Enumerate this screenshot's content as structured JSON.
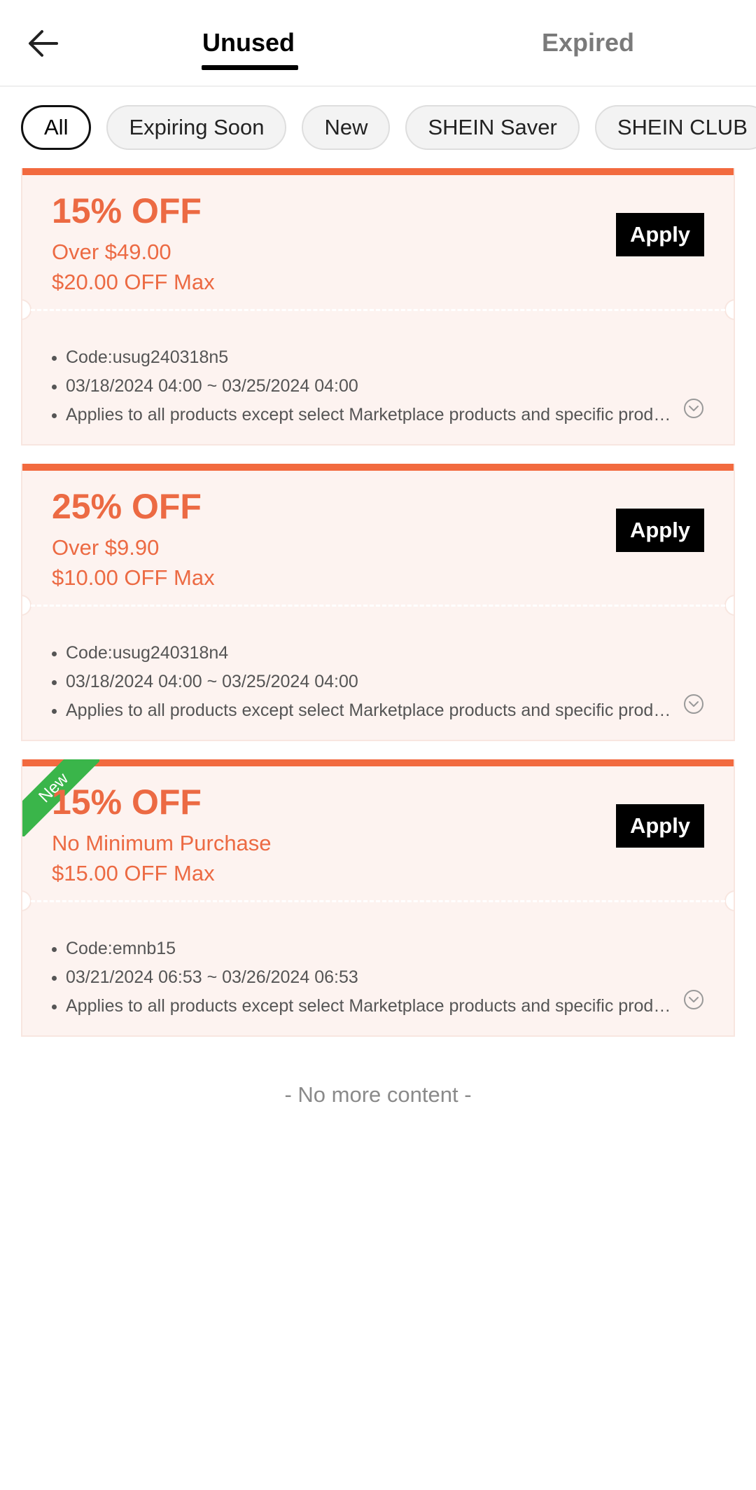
{
  "header": {
    "tabs": [
      {
        "label": "Unused",
        "active": true
      },
      {
        "label": "Expired",
        "active": false
      }
    ]
  },
  "filters": [
    "All",
    "Expiring Soon",
    "New",
    "SHEIN Saver",
    "SHEIN CLUB"
  ],
  "coupons": [
    {
      "discount": "15% OFF",
      "condition": "Over $49.00",
      "max": "$20.00 OFF Max",
      "apply_label": "Apply",
      "code": "Code:usug240318n5",
      "validity": "03/18/2024  04:00 ~ 03/25/2024  04:00",
      "description": "Applies to all products except select Marketplace products and specific products"
    },
    {
      "discount": "25% OFF",
      "condition": "Over $9.90",
      "max": "$10.00 OFF Max",
      "apply_label": "Apply",
      "code": "Code:usug240318n4",
      "validity": "03/18/2024  04:00 ~ 03/25/2024  04:00",
      "description": "Applies to all products except select Marketplace products and specific products"
    },
    {
      "discount": "15% OFF",
      "condition": "No Minimum Purchase",
      "max": "$15.00 OFF Max",
      "apply_label": "Apply",
      "code": "Code:emnb15",
      "validity": "03/21/2024  06:53 ~ 03/26/2024  06:53",
      "description": "Applies to all products except select Marketplace products and specific products",
      "badge": "New"
    }
  ],
  "footer": "- No more content -",
  "colors": {
    "accent": "#ec6a43",
    "top_bar": "#f26a3f",
    "coupon_bg": "#fdf3f0",
    "new_badge": "#3ab54a"
  }
}
